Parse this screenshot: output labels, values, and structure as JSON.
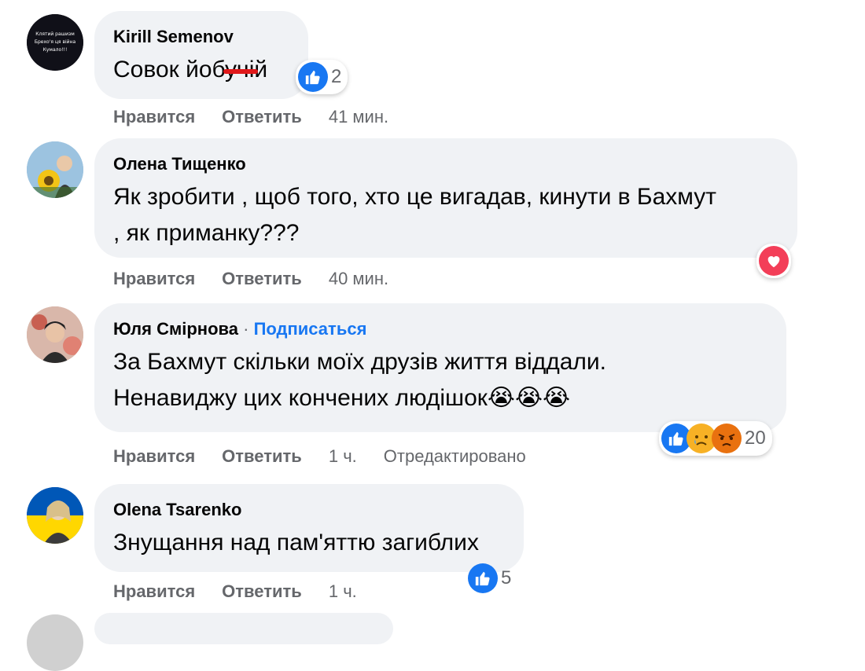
{
  "comments": [
    {
      "author": "Kirill Semenov",
      "text": "Совок йобучій",
      "avatar_lines": [
        "Клятий рашизм",
        "Брехо'я ця війна",
        "Кумало!!!"
      ],
      "like_label": "Нравится",
      "reply_label": "Ответить",
      "time": "41 мин.",
      "reaction_count": "2",
      "reactions": [
        "like-icon"
      ]
    },
    {
      "author": "Олена Тищенко",
      "text_line1": "Як зробити , щоб того, хто це вигадав, кинути в Бахмут",
      "text_line2": ", як приманку???",
      "like_label": "Нравится",
      "reply_label": "Ответить",
      "time": "40 мин.",
      "reactions": [
        "love-icon"
      ]
    },
    {
      "author": "Юля Смірнова",
      "separator": "·",
      "subscribe": "Подписаться",
      "text_line1": "За Бахмут скільки моїх друзів життя віддали.",
      "text_line2": "Ненавиджу цих кончених людішок😭😭😭",
      "like_label": "Нравится",
      "reply_label": "Ответить",
      "time": "1 ч.",
      "edited": "Отредактировано",
      "reaction_count": "20",
      "reactions": [
        "like-icon",
        "sad-icon",
        "angry-icon"
      ]
    },
    {
      "author": "Olena Tsarenko",
      "text": "Знущання над пам'яттю загиблих",
      "like_label": "Нравится",
      "reply_label": "Ответить",
      "time": "1 ч.",
      "reaction_count": "5",
      "reactions": [
        "like-icon"
      ]
    }
  ],
  "colors": {
    "bubble_bg": "#f0f2f5",
    "link_blue": "#1877f2",
    "meta_grey": "#65676b",
    "love_red": "#f33e58",
    "strike_red": "#e0191b"
  }
}
